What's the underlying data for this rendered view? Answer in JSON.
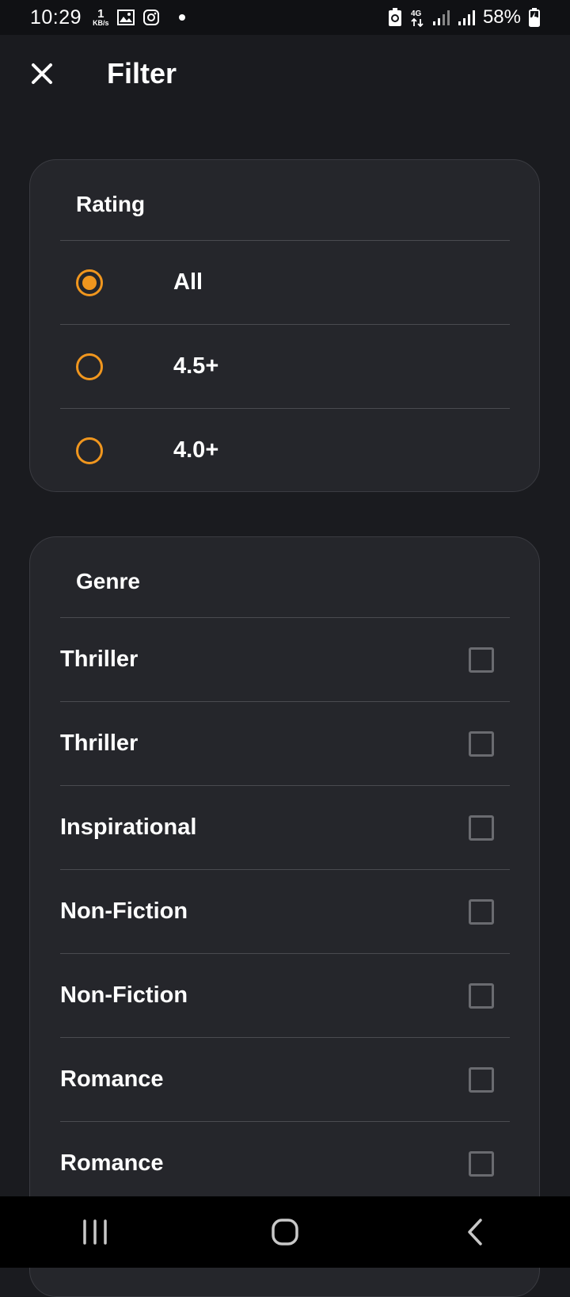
{
  "status_bar": {
    "time": "10:29",
    "speed_value": "1",
    "speed_unit": "KB/s",
    "network": "4G",
    "battery": "58%"
  },
  "header": {
    "title": "Filter"
  },
  "rating": {
    "title": "Rating",
    "options": [
      {
        "label": "All",
        "selected": true
      },
      {
        "label": "4.5+",
        "selected": false
      },
      {
        "label": "4.0+",
        "selected": false
      }
    ]
  },
  "genre": {
    "title": "Genre",
    "options": [
      {
        "label": "Thriller",
        "checked": false
      },
      {
        "label": "Thriller",
        "checked": false
      },
      {
        "label": "Inspirational",
        "checked": false
      },
      {
        "label": "Non-Fiction",
        "checked": false
      },
      {
        "label": "Non-Fiction",
        "checked": false
      },
      {
        "label": "Romance",
        "checked": false
      },
      {
        "label": "Romance",
        "checked": false
      }
    ]
  },
  "colors": {
    "accent": "#f0961e",
    "background": "#1a1b1f",
    "card": "#25262b"
  }
}
